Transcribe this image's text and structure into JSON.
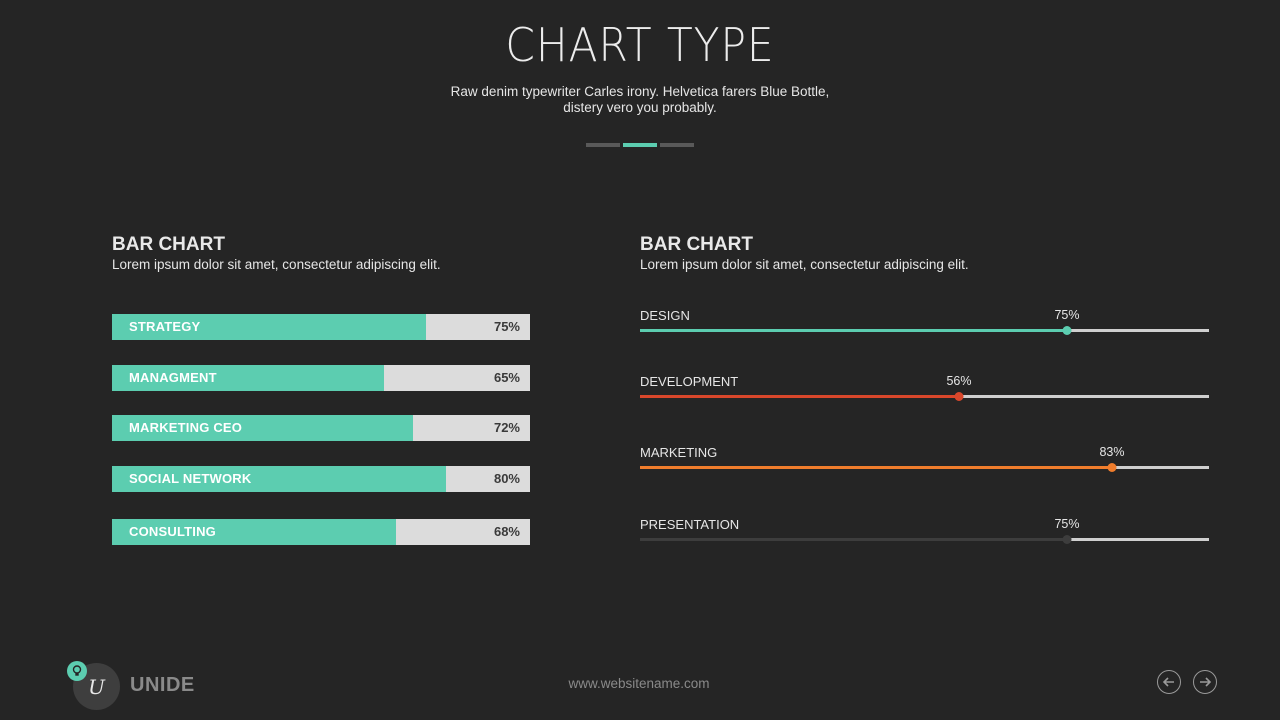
{
  "header": {
    "title": "CHART TYPE",
    "subtitle_line1": "Raw denim typewriter Carles irony. Helvetica farers Blue Bottle,",
    "subtitle_line2": "distery vero you probably."
  },
  "left_section": {
    "title": "BAR CHART",
    "description": "Lorem ipsum dolor sit amet, consectetur adipiscing elit."
  },
  "right_section": {
    "title": "BAR CHART",
    "description": "Lorem ipsum dolor sit amet, consectetur adipiscing elit."
  },
  "footer": {
    "brand": "UNIDE",
    "logo_letter": "U",
    "website": "www.websitename.com",
    "prev_icon": "arrow-left-circle-icon",
    "next_icon": "arrow-right-circle-icon"
  },
  "colors": {
    "accent": "#5ccdb0",
    "track": "#dcdcdc",
    "design": "#5ccdb0",
    "development": "#d9472b",
    "marketing": "#f07d2c",
    "presentation": "#3d3d3d"
  },
  "chart_data": [
    {
      "type": "bar",
      "orientation": "horizontal",
      "title": "BAR CHART",
      "categories": [
        "STRATEGY",
        "MANAGMENT",
        "MARKETING CEO",
        "SOCIAL NETWORK",
        "CONSULTING"
      ],
      "values": [
        75,
        65,
        72,
        80,
        68
      ],
      "value_labels": [
        "75%",
        "65%",
        "72%",
        "80%",
        "68%"
      ],
      "xlim": [
        0,
        100
      ],
      "bar_color": "#5ccdb0"
    },
    {
      "type": "bar",
      "orientation": "horizontal",
      "style": "slider",
      "title": "BAR CHART",
      "categories": [
        "DESIGN",
        "DEVELOPMENT",
        "MARKETING",
        "PRESENTATION"
      ],
      "values": [
        75,
        56,
        83,
        75
      ],
      "value_labels": [
        "75%",
        "56%",
        "83%",
        "75%"
      ],
      "colors": [
        "#5ccdb0",
        "#d9472b",
        "#f07d2c",
        "#3d3d3d"
      ],
      "xlim": [
        0,
        100
      ]
    }
  ]
}
